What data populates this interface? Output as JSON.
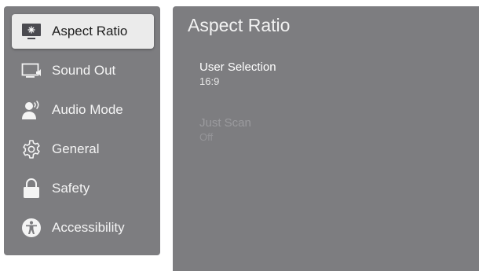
{
  "menu": {
    "items": [
      {
        "label": "Aspect Ratio",
        "icon": "aspect-ratio-icon",
        "selected": true
      },
      {
        "label": "Sound Out",
        "icon": "sound-out-icon",
        "selected": false
      },
      {
        "label": "Audio Mode",
        "icon": "audio-mode-icon",
        "selected": false
      },
      {
        "label": "General",
        "icon": "gear-icon",
        "selected": false
      },
      {
        "label": "Safety",
        "icon": "lock-icon",
        "selected": false
      },
      {
        "label": "Accessibility",
        "icon": "accessibility-icon",
        "selected": false
      }
    ]
  },
  "panel": {
    "title": "Aspect Ratio",
    "settings": [
      {
        "label": "User Selection",
        "value": "16:9",
        "enabled": true
      },
      {
        "label": "Just Scan",
        "value": "Off",
        "enabled": false
      }
    ]
  },
  "colors": {
    "panel_bg": "#7d7d80",
    "selected_bg": "#ebebeb",
    "text_light": "#f4f4f4",
    "text_dark": "#1e1e1e",
    "text_disabled": "#9b9b9e"
  }
}
